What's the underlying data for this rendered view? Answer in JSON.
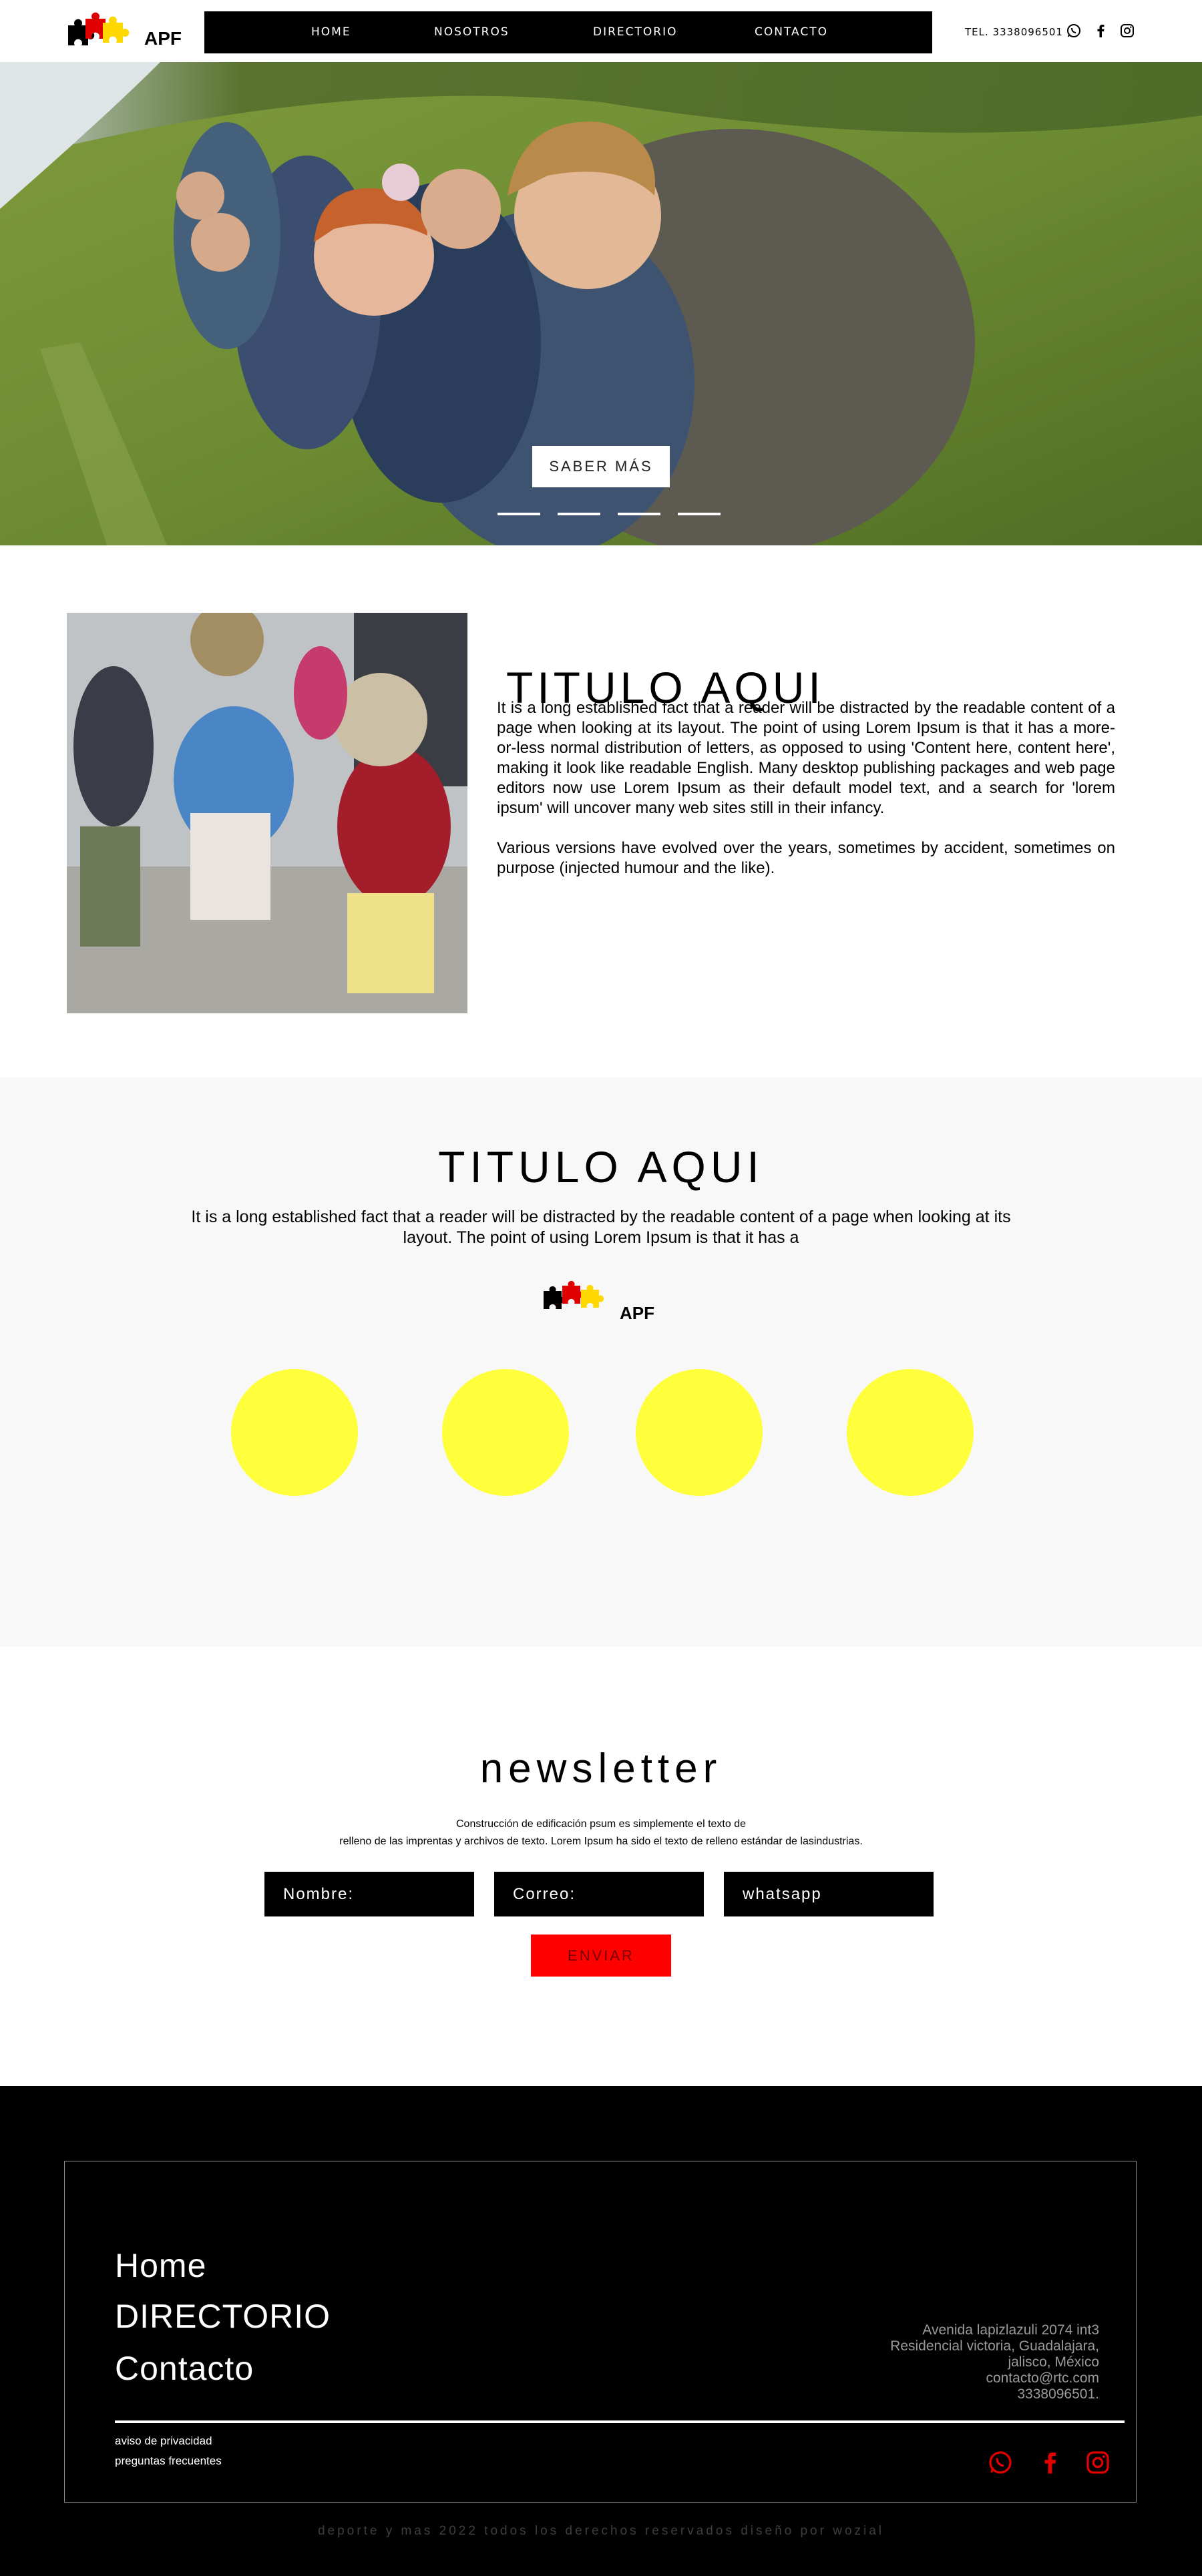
{
  "brand": {
    "logo_text": "APF",
    "colors": {
      "black": "#000000",
      "red": "#ff0000",
      "yellow": "#ffff3b",
      "light_gray": "#f8f8f8"
    }
  },
  "header": {
    "nav": [
      "HOME",
      "NOSOTROS",
      "DIRECTORIO",
      "CONTACTO"
    ],
    "tel": "TEL. 3338096501",
    "icons": [
      "whatsapp-icon",
      "facebook-icon",
      "instagram-icon"
    ]
  },
  "hero": {
    "button_label": "SABER MÁS",
    "slide_indicators": 4
  },
  "section_one": {
    "title": "TITULO AQUI",
    "paragraph_1": "It is a long established fact that a reader will be distracted by the readable content of a page when looking at its layout. The point of using Lorem Ipsum is that it has a more-or-less normal distribution of letters, as opposed to using 'Content here, content here', making it look like readable English. Many desktop publishing packages and web page editors now use Lorem Ipsum as their default model text, and a search for 'lorem ipsum' will uncover many web sites still in their infancy.",
    "paragraph_2": "Various versions have evolved over the years, sometimes by accident, sometimes on purpose (injected humour and the like)."
  },
  "section_two": {
    "title": "TITULO AQUI",
    "text": "It is a long established fact that a reader will be distracted by the readable content of a page when looking at its layout. The point of using Lorem Ipsum is that it has a",
    "logo_text": "APF",
    "circles": 4
  },
  "newsletter": {
    "title": "newsletter",
    "subtitle_line1": "Construcción de edificación psum es simplemente el texto de",
    "subtitle_line2": "relleno de las imprentas y archivos de texto. Lorem Ipsum ha sido el texto de relleno estándar de lasindustrias.",
    "name_placeholder": "Nombre:",
    "email_placeholder": "Correo:",
    "whatsapp_placeholder": "whatsapp",
    "submit_label": "ENVIAR"
  },
  "footer": {
    "links": [
      "Home",
      "DIRECTORIO",
      "Contacto"
    ],
    "address": [
      "Avenida lapizlazuli 2074 int3",
      "Residencial victoria, Guadalajara,",
      "jalisco, México",
      "contacto@rtc.com",
      "3338096501."
    ],
    "privacy": "aviso de privacidad",
    "faq": "preguntas frecuentes",
    "icons": [
      "whatsapp-icon",
      "facebook-icon",
      "instagram-icon"
    ],
    "copyright": "deporte y mas 2022 todos los derechos reservados diseño por wozial"
  }
}
